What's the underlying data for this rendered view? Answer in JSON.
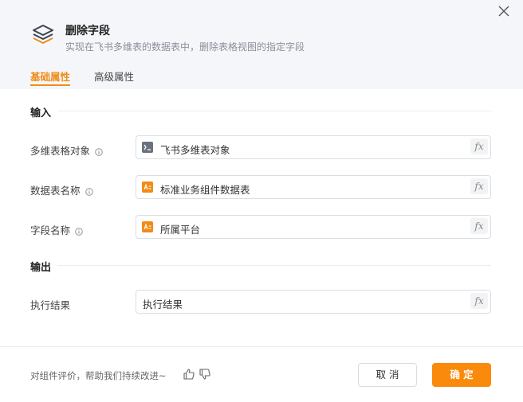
{
  "header": {
    "title": "删除字段",
    "subtitle": "实现在飞书多维表的数据表中，删除表格视图的指定字段",
    "logo_icon": "layers-icon",
    "close_icon": "close-icon"
  },
  "tabs": [
    {
      "label": "基础属性",
      "active": true
    },
    {
      "label": "高级属性",
      "active": false
    }
  ],
  "input_section": {
    "title": "输入",
    "fields": [
      {
        "label": "多维表格对象",
        "value": "飞书多维表对象",
        "icon": "object-icon"
      },
      {
        "label": "数据表名称",
        "value": "标准业务组件数据表",
        "icon": "text-type-icon"
      },
      {
        "label": "字段名称",
        "value": "所属平台",
        "icon": "text-type-icon"
      }
    ]
  },
  "output_section": {
    "title": "输出",
    "fields": [
      {
        "label": "执行结果",
        "value": "执行结果"
      }
    ]
  },
  "fx_label": "fx",
  "footer": {
    "feedback_text": "对组件评价，帮助我们持续改进~",
    "cancel_label": "取 消",
    "confirm_label": "确 定"
  },
  "colors": {
    "accent": "#fa8a0c",
    "header_bg": "#f4f6f9"
  }
}
